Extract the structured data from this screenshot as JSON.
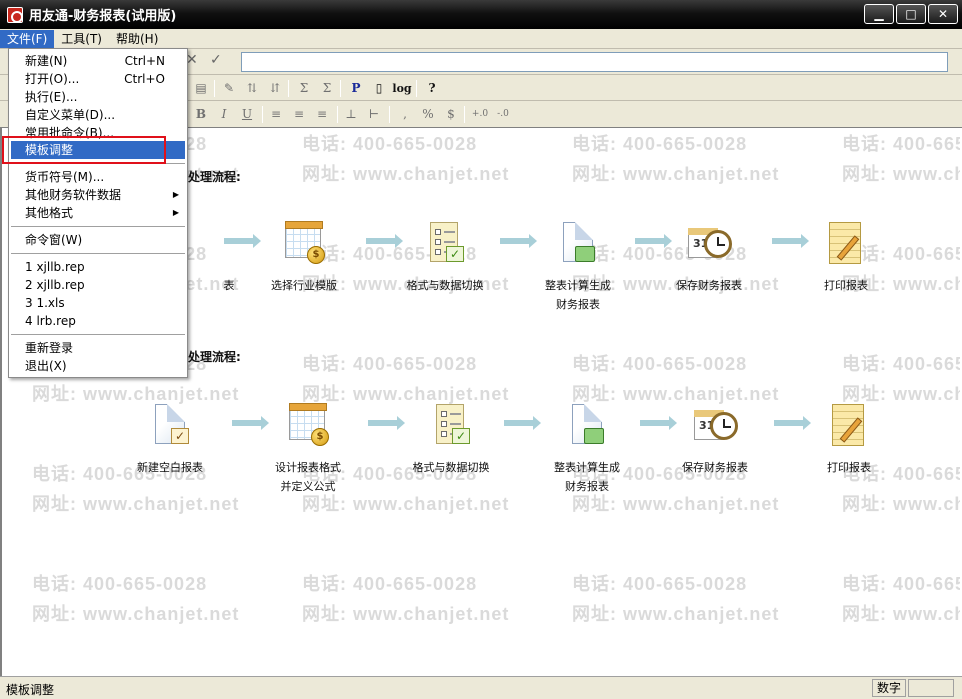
{
  "window": {
    "title": "用友通-财务报表(试用版)"
  },
  "menubar": {
    "items": [
      "文件(F)",
      "工具(T)",
      "帮助(H)"
    ]
  },
  "file_menu": {
    "new": "新建(N)",
    "new_shortcut": "Ctrl+N",
    "open": "打开(O)...",
    "open_shortcut": "Ctrl+O",
    "execute": "执行(E)...",
    "custom_menu": "自定义菜单(D)...",
    "batch_command": "常用批命令(B)...",
    "template_adjust": "模板调整",
    "currency_symbol": "货币符号(M)...",
    "other_software_data": "其他财务软件数据",
    "other_formats": "其他格式",
    "command_window": "命令窗(W)",
    "recent1": "1 xjllb.rep",
    "recent2": "2 xjllb.rep",
    "recent3": "3 1.xls",
    "recent4": "4 lrb.rep",
    "relogin": "重新登录",
    "exit": "退出(X)"
  },
  "toolbar": {
    "p_label": "P",
    "log_label": "log",
    "help_label": "?"
  },
  "flows": {
    "flow1_title": "处理流程:",
    "flow1_steps": [
      "表",
      "选择行业模版",
      "格式与数据切换",
      "整表计算生成\n财务报表",
      "保存财务报表",
      "打印报表"
    ],
    "flow2_title": "处理流程:",
    "flow2_steps": [
      "新建空白报表",
      "设计报表格式\n并定义公式",
      "格式与数据切换",
      "整表计算生成\n财务报表",
      "保存财务报表",
      "打印报表"
    ]
  },
  "watermark": {
    "phone": "电话: 400-665-0028",
    "site": "网址: www.chanjet.net"
  },
  "statusbar": {
    "text": "模板调整",
    "mode": "数字"
  },
  "colors": {
    "titlebar": "#000000",
    "menu_highlight": "#316ac5",
    "annotation_box": "#e0101a",
    "arrow": "#a8cfd8"
  }
}
